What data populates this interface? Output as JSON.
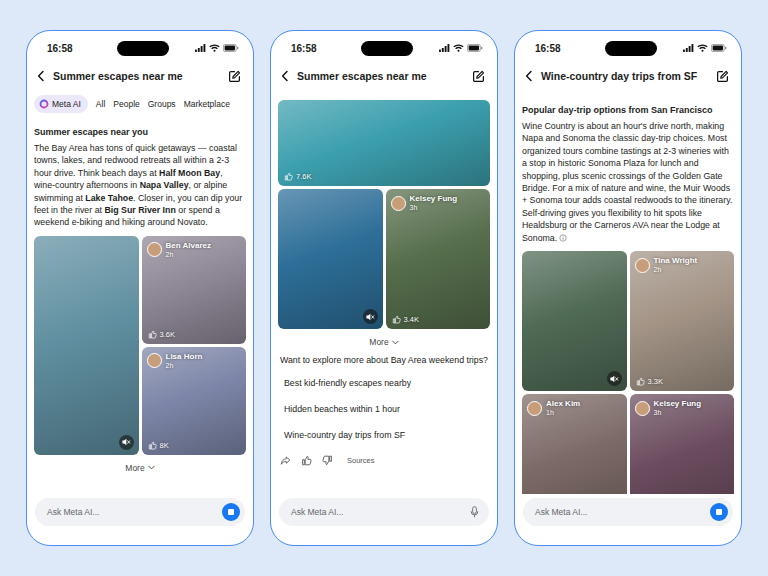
{
  "phones": [
    {
      "time": "16:58",
      "title": "Summer escapes near me",
      "tabs": [
        {
          "label": "Meta AI",
          "selected": true
        },
        {
          "label": "All",
          "selected": false
        },
        {
          "label": "People",
          "selected": false
        },
        {
          "label": "Groups",
          "selected": false
        },
        {
          "label": "Marketplace",
          "selected": false
        }
      ],
      "heading": "Summer escapes near you",
      "paragraph": [
        {
          "text": "The Bay Area has tons of quick getaways — coastal towns, lakes, and redwood retreats all within a 2-3 hour drive. Think beach days at ",
          "bold": false
        },
        {
          "text": "Half Moon Bay",
          "bold": true
        },
        {
          "text": ", wine-country afternoons in ",
          "bold": false
        },
        {
          "text": "Napa Valley",
          "bold": true
        },
        {
          "text": ", or alpine swimming at ",
          "bold": false
        },
        {
          "text": "Lake Tahoe",
          "bold": true
        },
        {
          "text": ". Closer in, you can dip your feet in the river at ",
          "bold": false
        },
        {
          "text": "Big Sur River Inn",
          "bold": true
        },
        {
          "text": " or spend a weekend e-biking and hiking around Novato.",
          "bold": false
        }
      ],
      "citation": false,
      "media": [
        {
          "kind": "tall",
          "color": "#5f8fa0",
          "muted": true
        },
        {
          "kind": "small",
          "color": "#8e8796",
          "muted": false,
          "author": "Ben Alvarez",
          "time": "2h",
          "likes": "3.6K"
        },
        {
          "kind": "small",
          "color": "#7d86a8",
          "muted": false,
          "author": "Lisa Horn",
          "time": "2h",
          "likes": "8K"
        }
      ],
      "more": "More",
      "input": {
        "placeholder": "Ask Meta AI...",
        "kind": "stop"
      }
    },
    {
      "time": "16:58",
      "title": "Summer escapes near me",
      "media": [
        {
          "kind": "wide",
          "color": "#3c9fae",
          "muted": false,
          "likes": "7.6K"
        },
        {
          "kind": "large",
          "color": "#2d6e98",
          "muted": true
        },
        {
          "kind": "large",
          "color": "#566e4c",
          "muted": false,
          "author": "Kelsey Fung",
          "time": "3h",
          "likes": "3.4K"
        }
      ],
      "more": "More",
      "prompt": "Want to explore more about Bay Area weekend trips?",
      "suggestions": [
        "Best kid-friendly escapes nearby",
        "Hidden beaches within 1 hour",
        "Wine-country day trips from SF"
      ],
      "sources": "Sources",
      "input": {
        "placeholder": "Ask Meta AI...",
        "kind": "mic"
      }
    },
    {
      "time": "16:58",
      "title": "Wine-country day trips from SF",
      "heading": "Popular day-trip options from San Francisco",
      "paragraph": [
        {
          "text": "Wine Country is about an hour's drive north, making Napa and Sonoma the classic day-trip choices. Most organized tours combine tastings at 2-3 wineries with a stop in historic Sonoma Plaza for lunch and shopping, plus scenic crossings of the Golden Gate Bridge. For a mix of nature and wine, the Muir Woods + Sonoma tour adds coastal redwoods to the itinerary. Self-driving gives you flexibility to hit spots like Healdsburg or the Carneros AVA near the Lodge at Sonoma.",
          "bold": false
        }
      ],
      "citation": true,
      "media": [
        {
          "kind": "large",
          "color": "#4f6a55",
          "muted": true
        },
        {
          "kind": "large",
          "color": "#a39486",
          "muted": false,
          "author": "Tina Wright",
          "time": "2h",
          "likes": "3.3K"
        },
        {
          "kind": "large",
          "color": "#7c6a66",
          "muted": false,
          "author": "Alex Kim",
          "time": "1h"
        },
        {
          "kind": "large",
          "color": "#6a4c5e",
          "muted": false,
          "author": "Kelsey Fung",
          "time": "3h"
        }
      ],
      "input": {
        "placeholder": "Ask Meta AI...",
        "kind": "stop"
      }
    }
  ]
}
